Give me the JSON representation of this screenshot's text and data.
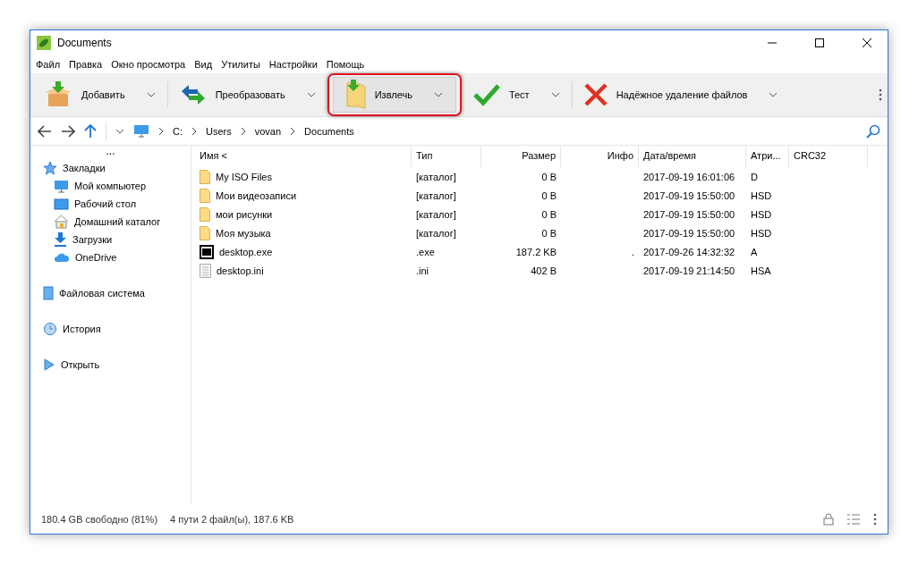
{
  "window": {
    "title": "Documents"
  },
  "menu": [
    "Файл",
    "Правка",
    "Окно просмотра",
    "Вид",
    "Утилиты",
    "Настройки",
    "Помощь"
  ],
  "toolbar": [
    {
      "label": "Добавить",
      "highlighted": false
    },
    {
      "label": "Преобразовать",
      "highlighted": false
    },
    {
      "label": "Извлечь",
      "highlighted": true
    },
    {
      "label": "Тест",
      "highlighted": false
    },
    {
      "label": "Надёжное удаление файлов",
      "highlighted": false
    }
  ],
  "path": [
    "C:",
    "Users",
    "vovan",
    "Documents"
  ],
  "sidebar": {
    "more": "...",
    "sections": [
      {
        "label": "Закладки",
        "children": [
          {
            "label": "Мой компьютер"
          },
          {
            "label": "Рабочий стол"
          },
          {
            "label": "Домашний каталог"
          },
          {
            "label": "Загрузки"
          },
          {
            "label": "OneDrive"
          }
        ]
      },
      {
        "label": "Файловая система"
      },
      {
        "label": "История"
      },
      {
        "label": "Открыть"
      }
    ]
  },
  "table": {
    "columns": [
      "Имя <",
      "Тип",
      "Размер",
      "Инфо",
      "Дата/время",
      "Атри...",
      "CRC32"
    ],
    "rows": [
      {
        "kind": "folder",
        "cells": [
          "My ISO Files",
          "[каталог]",
          "0 B",
          "",
          "2017-09-19 16:01:06",
          "D",
          ""
        ]
      },
      {
        "kind": "folder",
        "cells": [
          "Мои видеозаписи",
          "[каталог]",
          "0 B",
          "",
          "2017-09-19 15:50:00",
          "HSD",
          ""
        ]
      },
      {
        "kind": "folder",
        "cells": [
          "мои рисунки",
          "[каталог]",
          "0 B",
          "",
          "2017-09-19 15:50:00",
          "HSD",
          ""
        ]
      },
      {
        "kind": "folder",
        "cells": [
          "Моя музыка",
          "[каталог]",
          "0 B",
          "",
          "2017-09-19 15:50:00",
          "HSD",
          ""
        ]
      },
      {
        "kind": "exe",
        "cells": [
          "desktop.exe",
          ".exe",
          "187.2 KB",
          ".",
          "2017-09-26 14:32:32",
          "A",
          ""
        ]
      },
      {
        "kind": "file",
        "cells": [
          "desktop.ini",
          ".ini",
          "402 B",
          "",
          "2017-09-19 21:14:50",
          "HSA",
          ""
        ]
      }
    ]
  },
  "status_bar": {
    "free": "180.4 GB свободно (81%)",
    "summary": "4 пути 2 файл(ы), 187.6 KB"
  }
}
